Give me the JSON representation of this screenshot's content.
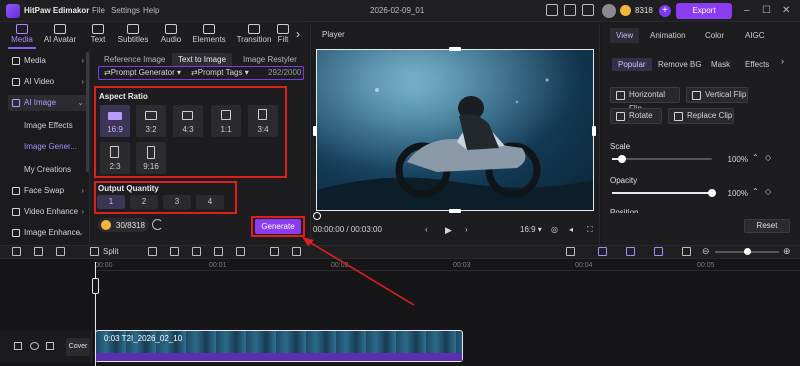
{
  "app": {
    "title": "HitPaw Edimakor",
    "menu": [
      "File",
      "Settings",
      "Help"
    ],
    "project": "2026-02-09_01",
    "credits": "8318",
    "export_label": "Export"
  },
  "toolbar": {
    "tabs": [
      "Media",
      "AI Avatar",
      "Text",
      "Subtitles",
      "Audio",
      "Elements",
      "Transition",
      "Filt"
    ]
  },
  "sidebar": {
    "items": [
      "Media",
      "AI Video",
      "AI Image",
      "Face Swap",
      "Video Enhance",
      "Image Enhance"
    ],
    "subitems": [
      "Image Effects",
      "Image Gener...",
      "My Creations"
    ]
  },
  "panel": {
    "tabs": [
      "Reference Image",
      "Text to Image",
      "Image Restyler"
    ],
    "prompt_generator": "Prompt Generator",
    "prompt_tags": "Prompt Tags",
    "char_count": "292/2000",
    "aspect_title": "Aspect Ratio",
    "ratios": [
      "16:9",
      "3:2",
      "4:3",
      "1:1",
      "3:4",
      "2:3",
      "9:16"
    ],
    "quantity_title": "Output Quantity",
    "quantities": [
      "1",
      "2",
      "3",
      "4"
    ],
    "credit_usage": "30/8318",
    "generate_label": "Generate"
  },
  "player": {
    "title": "Player",
    "timecode": "00:00:00 / 00:03:00",
    "aspect": "16:9"
  },
  "right": {
    "tabs": [
      "View",
      "Animation",
      "Color",
      "AIGC"
    ],
    "subtabs": [
      "Popular",
      "Remove BG",
      "Mask",
      "Effects"
    ],
    "buttons": [
      "Horizontal Flip",
      "Vertical Flip",
      "Rotate",
      "Replace Clip"
    ],
    "scale_label": "Scale",
    "scale_value": "100%",
    "scale_level": 0.1,
    "opacity_label": "Opacity",
    "opacity_value": "100%",
    "opacity_level": 1.0,
    "position_label": "Position",
    "reset_label": "Reset"
  },
  "timeline": {
    "split_label": "Split",
    "ruler": [
      "00:00",
      "00:01",
      "00:02",
      "00:03",
      "00:04",
      "00:05"
    ],
    "cover_label": "Cover",
    "clip_label": "0:03 T2I_2026_02_10"
  },
  "colors": {
    "accent": "#8b3cf0",
    "highlight_box": "#e01e1e"
  }
}
